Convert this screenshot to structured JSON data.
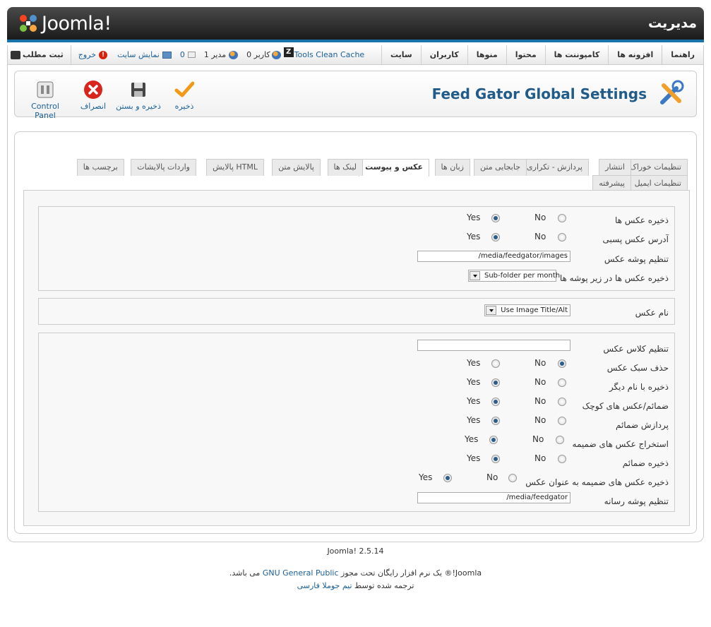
{
  "header": {
    "logo_text": "Joomla!",
    "title": "مدیریت"
  },
  "menu": {
    "items": [
      "سایت",
      "کاربران",
      "منوها",
      "محتوا",
      "کامپوننت ها",
      "افزونه ها",
      "راهنما"
    ]
  },
  "status": {
    "cache": "Tools Clean Cache",
    "users_count": "0",
    "users_label": "کاربر",
    "admins_count": "1",
    "admins_label": "مدیر",
    "messages_count": "0",
    "view_site": "نمایش سایت",
    "logout": "خروج",
    "new_article": "ثبت مطلب"
  },
  "toolbar": {
    "title": "Feed Gator Global Settings",
    "save": "ذخیره",
    "save_close": "ذخیره و بستن",
    "cancel": "انصراف",
    "control_panel": "Control Panel"
  },
  "tabs_row1": [
    "تنظیمات خوراک",
    "انتشار",
    "پردازش - تکراری",
    "جابجایی متن",
    "زبان ها",
    "عکس و پیوست",
    "لینک ها",
    "پالایش متن",
    "پالایش HTML",
    "واردات پالایشات",
    "برچسب ها"
  ],
  "tabs_row2": [
    "تنظیمات ایمیل",
    "پیشرفته"
  ],
  "active_tab": "عکس و پیوست",
  "yes": "Yes",
  "no": "No",
  "fieldset1": {
    "save_images": "ذخیره عکس ها",
    "image_suffix": "آدرس عکس پسبی",
    "image_folder_label": "تنظیم پوشه عکس",
    "image_folder_value": "/media/feedgator/images",
    "subfolder_label": "ذخیره عکس ها در زیر پوشه ها",
    "subfolder_value": "Sub-folder per month"
  },
  "fieldset2": {
    "image_name_label": "نام عکس",
    "image_name_value": "Use Image Title/Alt"
  },
  "fieldset3": {
    "class_label": "تنظیم کلاس عکس",
    "class_value": "",
    "remove_style": "حذف سبک عکس",
    "save_other_name": "ذخیره با نام دیگر",
    "thumbs": "ضمائم/عکس های کوچک",
    "process_attachments": "پردازش ضمائم",
    "extract_attached": "استخراج عکس های ضمیمه",
    "save_attachments": "ذخیره ضمائم",
    "save_attached_as_image": "ذخیره عکس های ضمیمه به عنوان عکس",
    "media_folder_label": "تنظیم پوشه رسانه",
    "media_folder_value": "/media/feedgator"
  },
  "footer": {
    "version": "Joomla! 2.5.14",
    "license_pre": "Joomla!® یک نرم افزار رایگان تحت مجوز",
    "license_link": "GNU General Public",
    "license_post": "می باشد.",
    "translated_pre": "ترجمه شده توسط",
    "translated_link": "تیم جوملا فارسی"
  },
  "colors": {
    "accent": "#215b8a",
    "header_bar": "#1873aa",
    "link": "#1b5f97"
  }
}
